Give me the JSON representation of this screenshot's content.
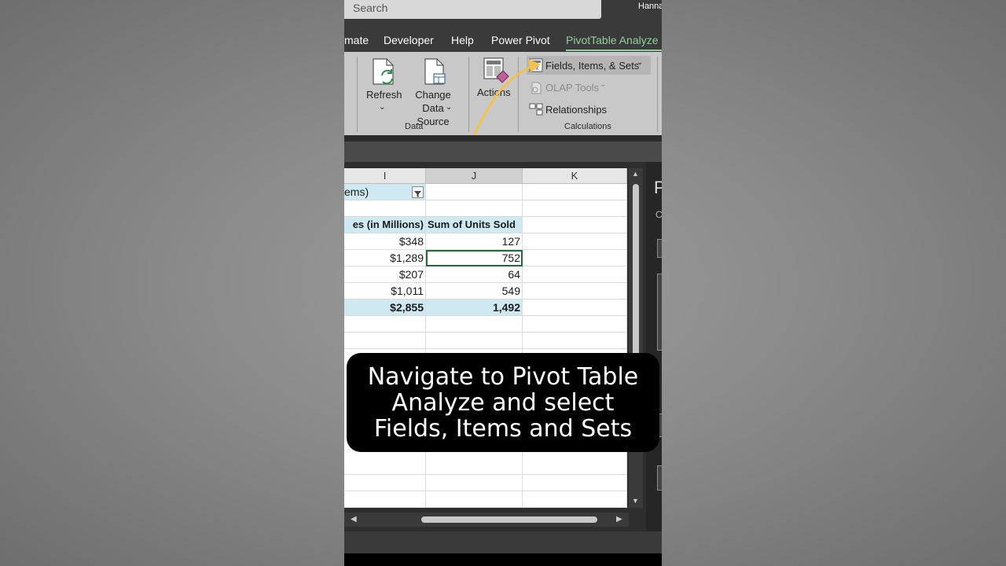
{
  "titlebar": {
    "search_placeholder": "Search",
    "user": "Hanna"
  },
  "tabs": [
    {
      "label": "mate"
    },
    {
      "label": "Developer"
    },
    {
      "label": "Help"
    },
    {
      "label": "Power Pivot"
    },
    {
      "label": "PivotTable Analyze",
      "active": true
    }
  ],
  "ribbon": {
    "refresh_label": "Refresh",
    "change_data_source_label": "Change Data\nSource",
    "data_group_label": "Data",
    "actions_label": "Actions",
    "fields_items_sets_label": "Fields, Items, & Sets",
    "olap_tools_label": "OLAP Tools",
    "relationships_label": "Relationships",
    "calculations_group_label": "Calculations"
  },
  "sheet": {
    "columns": [
      {
        "label": "I"
      },
      {
        "label": "J"
      },
      {
        "label": "K"
      }
    ],
    "filter_cell": "ems)",
    "headers": [
      "es (in Millions)",
      "Sum of Units Sold"
    ],
    "rows": [
      {
        "sales": "$348",
        "units": "127"
      },
      {
        "sales": "$1,289",
        "units": "752"
      },
      {
        "sales": "$207",
        "units": "64"
      },
      {
        "sales": "$1,011",
        "units": "549"
      }
    ],
    "total": {
      "sales": "$2,855",
      "units": "1,492"
    }
  },
  "side_pane": {
    "title_letter": "P",
    "subtitle_letter": "C"
  },
  "caption": "Navigate to Pivot Table\nAnalyze and select\nFields, Items and Sets",
  "colors": {
    "accent_tab": "#8fd19e",
    "arrow": "#f2c14e",
    "pivot_header": "#cfe9f3",
    "active_cell_border": "#1e6e3a"
  }
}
